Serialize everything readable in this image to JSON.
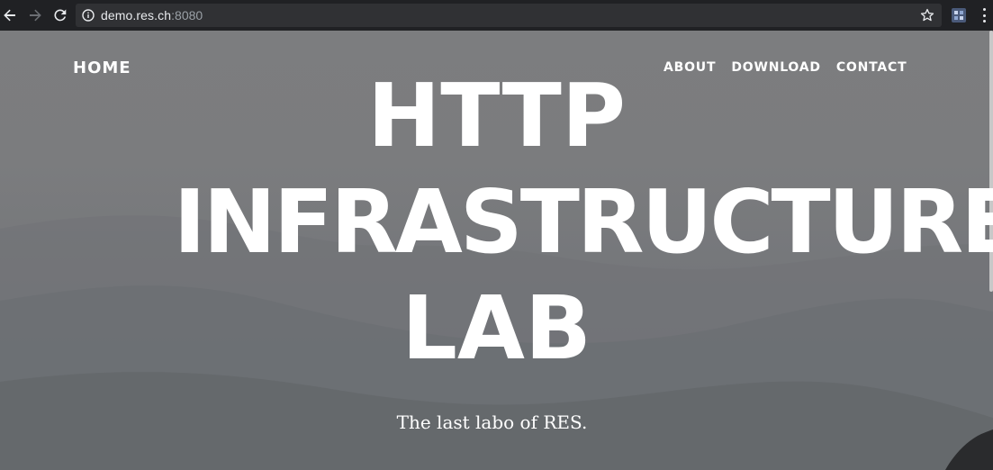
{
  "browser": {
    "url_host": "demo.res.ch",
    "url_port": ":8080",
    "icons": {
      "back": "back-arrow-icon",
      "forward": "forward-arrow-icon",
      "reload": "reload-icon",
      "info": "info-icon",
      "bookmark": "star-icon",
      "extension": "extension-icon",
      "menu": "kebab-menu-icon"
    },
    "colors": {
      "chrome_bg": "#202124",
      "omnibox_bg": "#303134",
      "text": "#e8eaed",
      "muted": "#9aa0a6"
    }
  },
  "site": {
    "nav": {
      "home": "HOME",
      "links": [
        "ABOUT",
        "DOWNLOAD",
        "CONTACT"
      ]
    },
    "hero": {
      "line1": "HTTP",
      "line2": "INFRASTRUCTURE",
      "line3": "LAB",
      "subtitle": "The last labo of RES."
    },
    "colors": {
      "text": "#ffffff",
      "overlay": "#7b7c7e"
    }
  }
}
